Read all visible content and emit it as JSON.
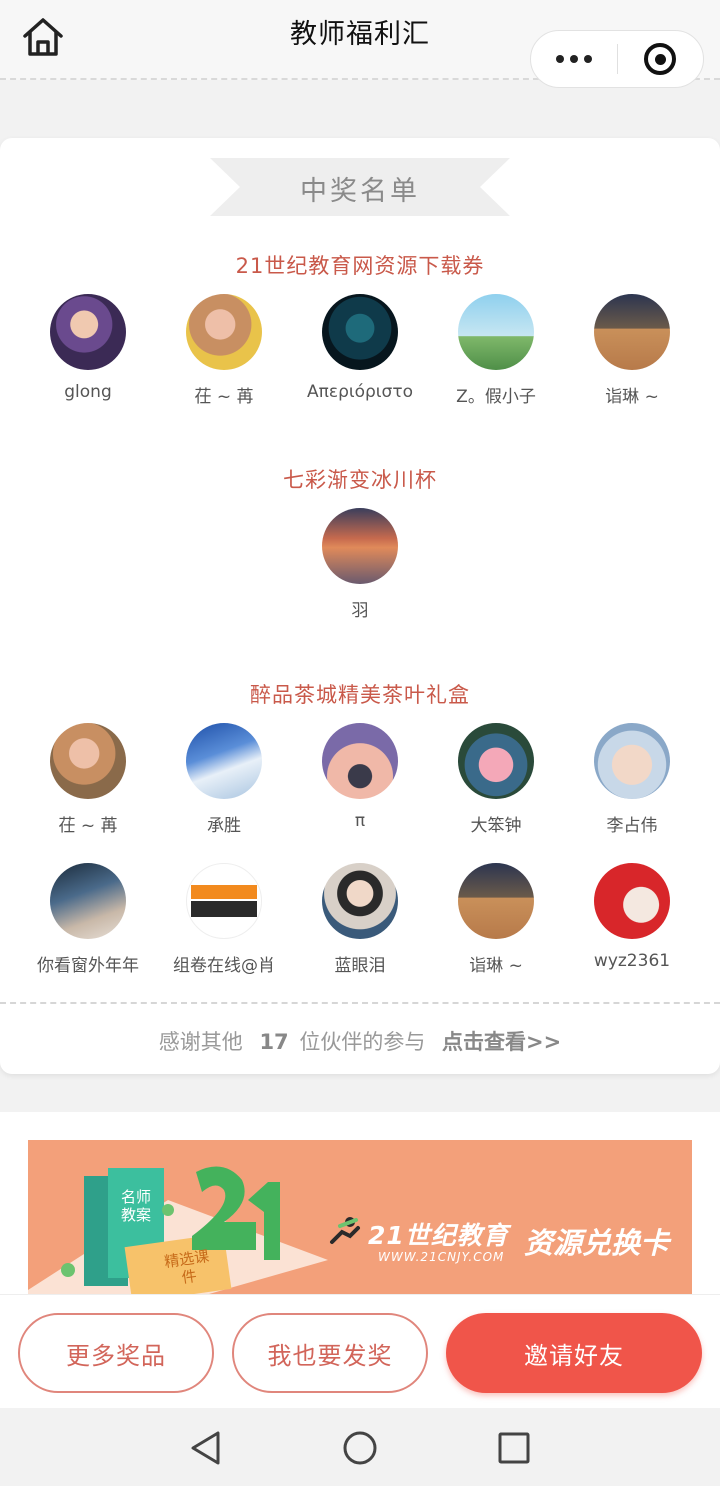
{
  "nav": {
    "title": "教师福利汇",
    "icons": {
      "home": "home-icon",
      "more": "more-dots-icon",
      "close": "close-target-icon"
    }
  },
  "winners_section": {
    "heading": "中奖名单",
    "prizes": [
      {
        "title": "21世纪教育网资源下载券",
        "winners": [
          {
            "name": "glong"
          },
          {
            "name": "茌 ~ 苒"
          },
          {
            "name": "Απεριόριστο"
          },
          {
            "name": "Z。假小子"
          },
          {
            "name": "诣琳 ~"
          }
        ]
      },
      {
        "title": "七彩渐变冰川杯",
        "winners": [
          {
            "name": "羽"
          }
        ]
      },
      {
        "title": "醉品茶城精美茶叶礼盒",
        "winners": [
          {
            "name": "茌 ~ 苒"
          },
          {
            "name": "承胜"
          },
          {
            "name": "π"
          },
          {
            "name": "大笨钟"
          },
          {
            "name": "李占伟"
          },
          {
            "name": "你看窗外年年"
          },
          {
            "name": "组卷在线@肖"
          },
          {
            "name": "蓝眼泪"
          },
          {
            "name": "诣琳 ~"
          },
          {
            "name": "wyz2361"
          }
        ]
      }
    ],
    "thanks": {
      "prefix": "感谢其他",
      "count": "17",
      "suffix": "位伙伴的参与",
      "link": "点击查看>>"
    }
  },
  "banner": {
    "book_a": "名师教案",
    "book_b": "精选课件",
    "big_number": "21",
    "brand": "21世纪教育",
    "url": "WWW.21CNJY.COM",
    "slogan": "资源兑换卡"
  },
  "actions": {
    "more_prizes": "更多奖品",
    "i_give_prize": "我也要发奖",
    "invite_friends": "邀请好友"
  },
  "colors": {
    "accent": "#f0554a",
    "prize_title": "#c9594a",
    "banner_bg": "#f3a07a"
  }
}
